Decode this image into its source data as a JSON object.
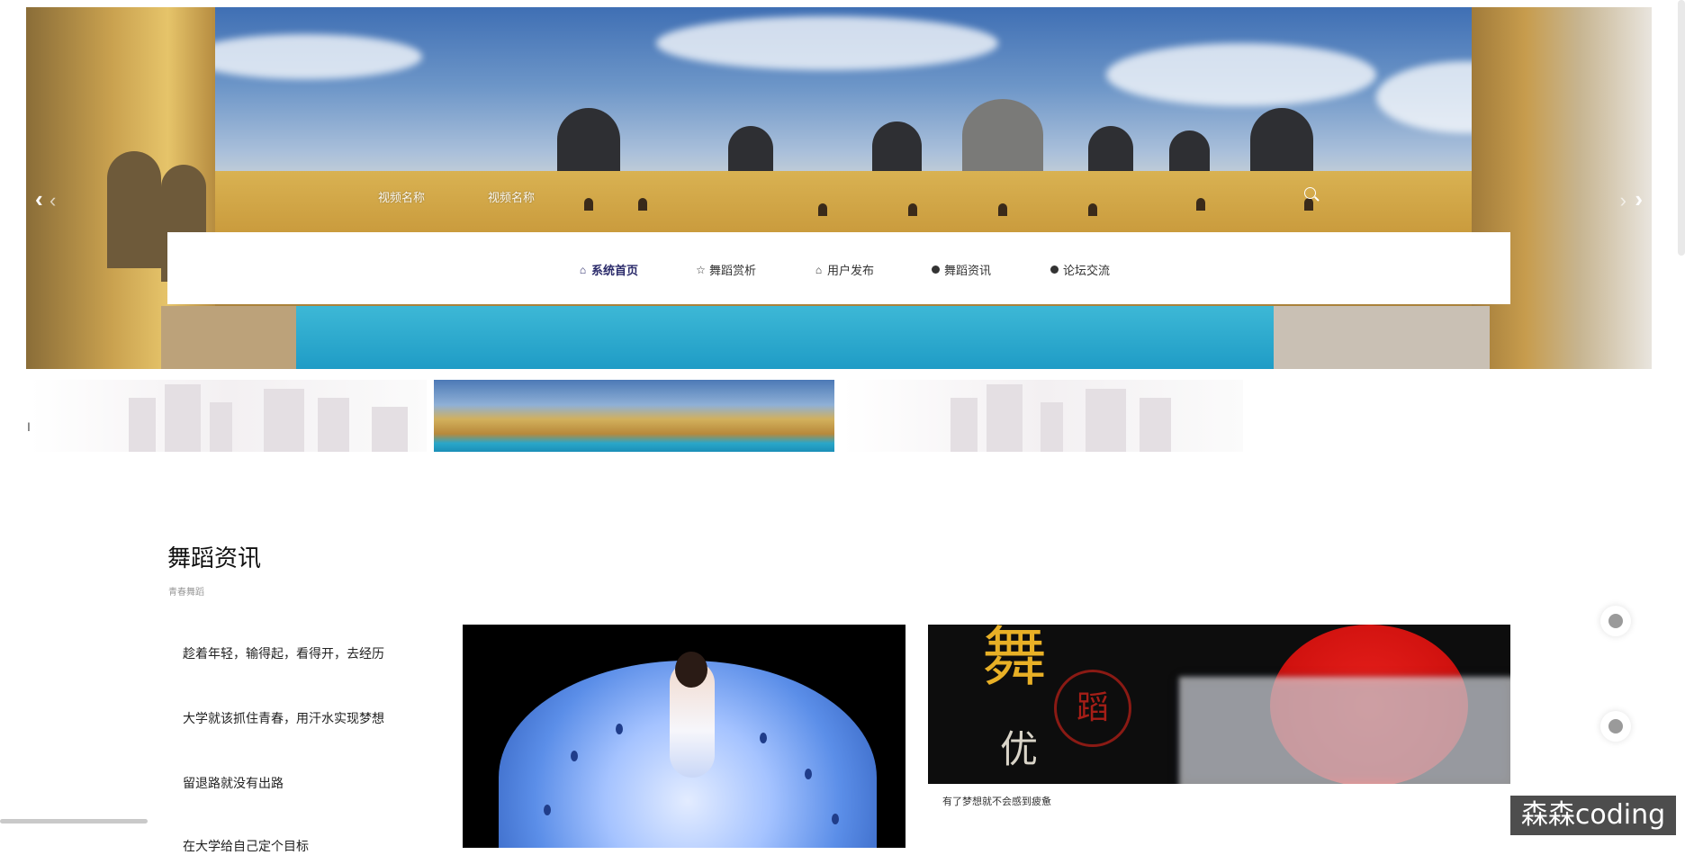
{
  "top_nav": {
    "item1": "视频名称",
    "item2": "视频名称"
  },
  "nav": {
    "items": [
      {
        "label": "系统首页",
        "icon": "home-icon",
        "active": true
      },
      {
        "label": "舞蹈赏析",
        "icon": "star-icon",
        "active": false
      },
      {
        "label": "用户发布",
        "icon": "bag-icon",
        "active": false
      },
      {
        "label": "舞蹈资讯",
        "icon": "info-icon",
        "active": false
      },
      {
        "label": "论坛交流",
        "icon": "help-icon",
        "active": false
      }
    ]
  },
  "section": {
    "title": "舞蹈资讯",
    "subtitle": "青春舞蹈",
    "news": [
      "趁着年轻，输得起，看得开，去经历",
      "大学就该抓住青春，用汗水实现梦想",
      "留退路就没有出路",
      "在大学给自己定个目标"
    ],
    "card2_caption": "有了梦想就不会感到疲惫",
    "card2_text_a": "舞",
    "card2_text_b": "优",
    "card2_circle": "蹈"
  },
  "watermark": "森森coding",
  "colors": {
    "accent": "#2a2a6a",
    "pool": "#1f9cc6",
    "palace": "#c99a3c"
  }
}
